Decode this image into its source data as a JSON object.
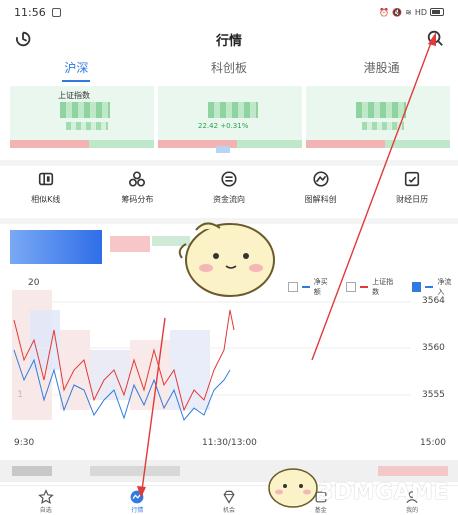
{
  "status_bar": {
    "time": "11:56",
    "network": "HD"
  },
  "header": {
    "title": "行情"
  },
  "tabs": [
    {
      "label": "沪深",
      "active": true
    },
    {
      "label": "科创板",
      "active": false
    },
    {
      "label": "港股通",
      "active": false
    }
  ],
  "indices": [
    {
      "name": "上证指数",
      "change": ""
    },
    {
      "name": "",
      "change": "22.42 +0.31%"
    },
    {
      "name": "",
      "change": ""
    }
  ],
  "tools": [
    {
      "label": "相似K线",
      "icon": "kline-icon"
    },
    {
      "label": "筹码分布",
      "icon": "chips-icon"
    },
    {
      "label": "资金流向",
      "icon": "money-flow-icon"
    },
    {
      "label": "图解科创",
      "icon": "chart-guide-icon"
    },
    {
      "label": "财经日历",
      "icon": "calendar-icon"
    }
  ],
  "chart": {
    "legend": [
      {
        "label": "净买额",
        "checked": false,
        "color": "#2f7be0"
      },
      {
        "label": "上证指数",
        "checked": false,
        "color": "#e03a3a"
      },
      {
        "label": "净流入",
        "checked": true,
        "color": "#2f7be0"
      }
    ],
    "y_ticks": [
      "3564",
      "3560",
      "3555"
    ],
    "left_ticks": [
      "20",
      "-1"
    ],
    "x_ticks": [
      "9:30",
      "11:30/13:00",
      "15:00"
    ]
  },
  "bottom_nav": [
    {
      "label": "自选",
      "icon": "star-icon",
      "active": false
    },
    {
      "label": "行情",
      "icon": "market-icon",
      "active": true
    },
    {
      "label": "机会",
      "icon": "diamond-icon",
      "active": false
    },
    {
      "label": "基金",
      "icon": "fund-icon",
      "active": false
    },
    {
      "label": "我的",
      "icon": "user-icon",
      "active": false
    }
  ],
  "watermark": {
    "text": "3DMGAME"
  },
  "colors": {
    "accent": "#2f7be0",
    "up": "#e03a3a",
    "down": "#2aa14f"
  }
}
